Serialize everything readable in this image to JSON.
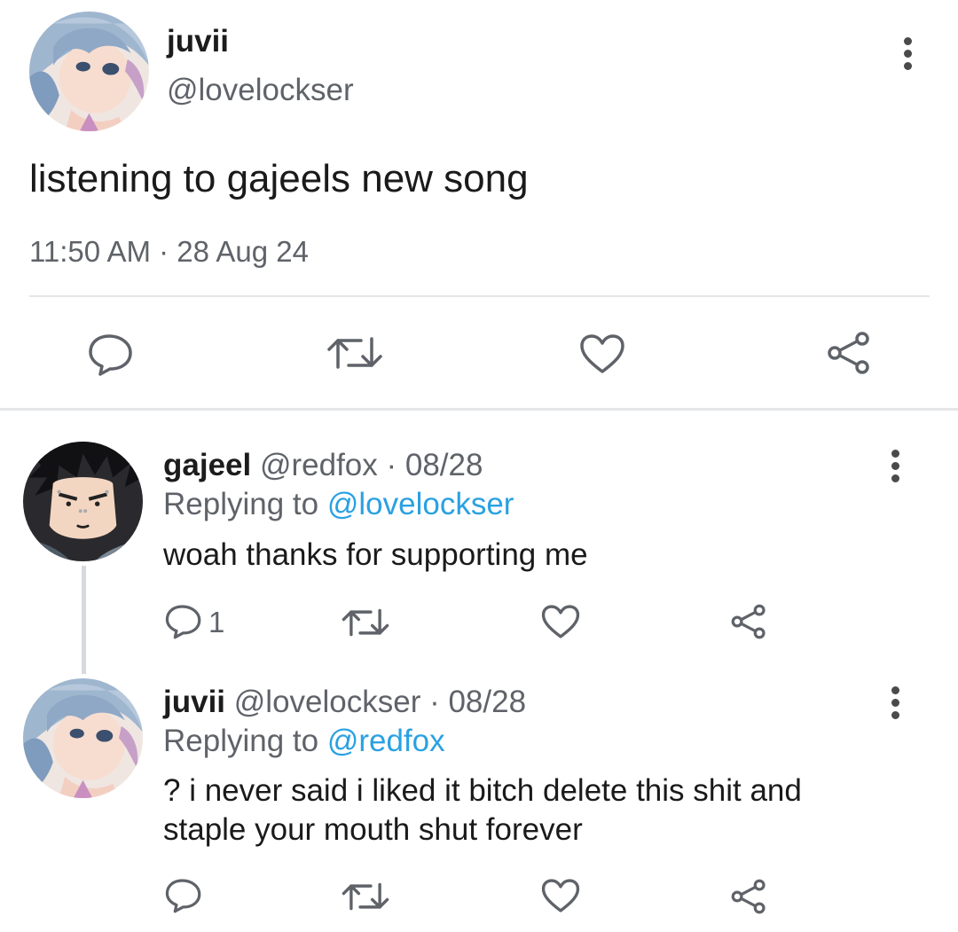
{
  "main_tweet": {
    "display_name": "juvii",
    "handle": "@lovelockser",
    "text": "listening to gajeels new song",
    "timestamp": "11:50 AM · 28 Aug 24"
  },
  "replies": [
    {
      "display_name": "gajeel",
      "handle_date": "@redfox · 08/28",
      "replying_prefix": "Replying to",
      "replying_to": "@lovelockser",
      "text": "woah thanks for supporting me",
      "reply_count": "1"
    },
    {
      "display_name": "juvii",
      "handle_date": "@lovelockser · 08/28",
      "replying_prefix": "Replying to",
      "replying_to": "@redfox",
      "text_line1": "? i never said i liked it bitch delete this shit and",
      "text_line2": "staple your mouth shut forever"
    }
  ],
  "icons": {
    "reply": "speech-bubble-icon",
    "retweet": "retweet-arrows-icon",
    "like": "heart-icon",
    "share": "share-nodes-icon",
    "more": "vertical-ellipsis-icon"
  },
  "colors": {
    "link": "#2aa1e2",
    "secondary_text": "#5f6369",
    "icon": "#5f6369"
  }
}
